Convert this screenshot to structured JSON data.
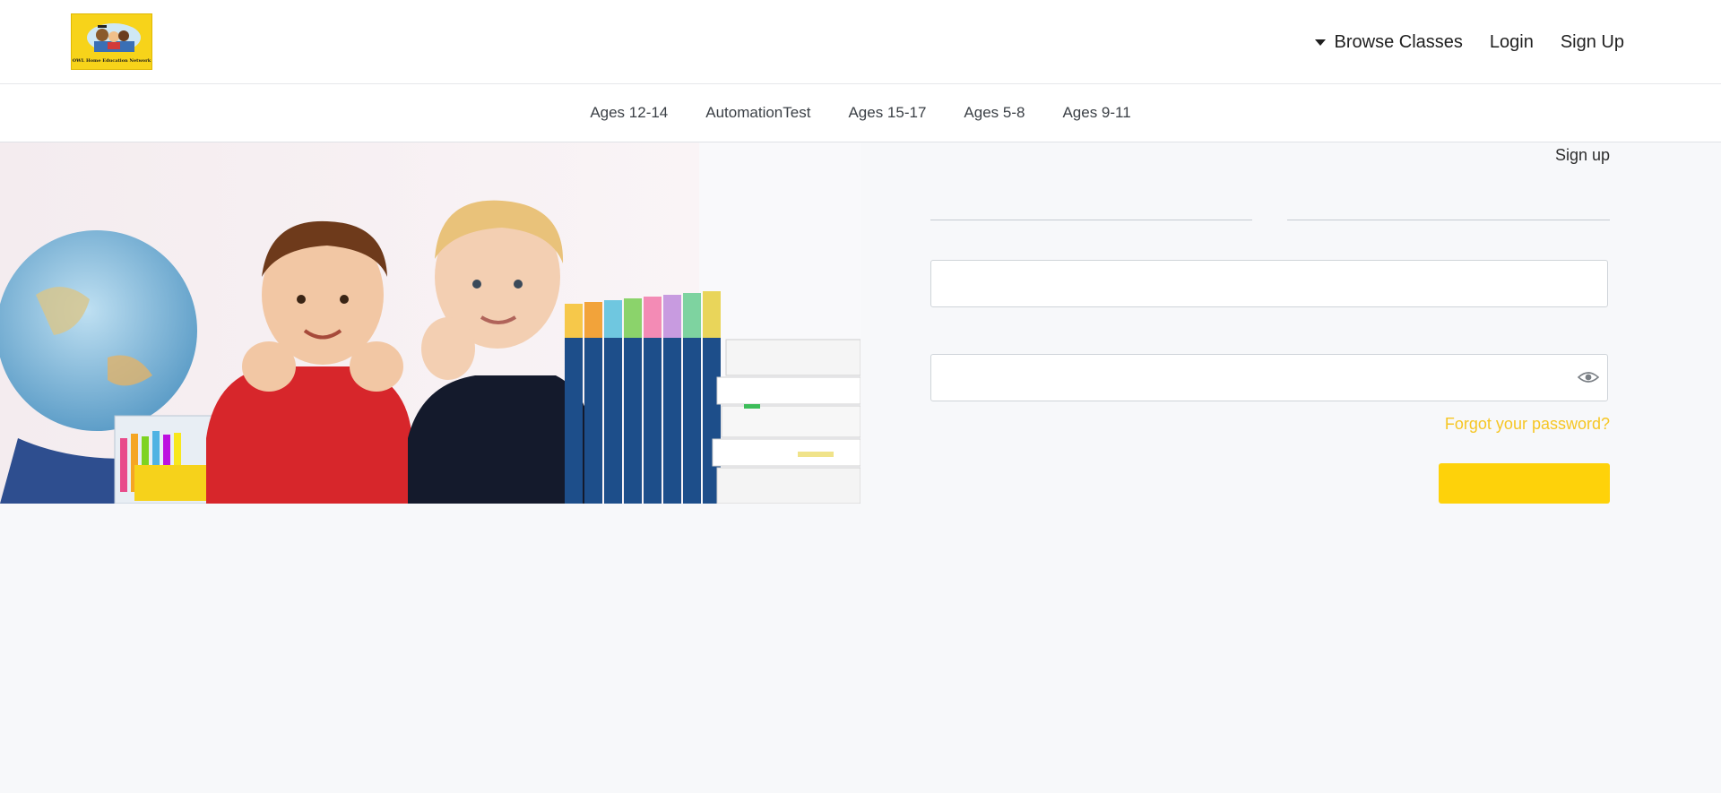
{
  "header": {
    "logo_text": "OWL Home Education Network",
    "nav": {
      "browse_label": "Browse Classes",
      "login_label": "Login",
      "signup_label": "Sign Up"
    }
  },
  "categories": [
    "Ages 12-14",
    "AutomationTest",
    "Ages 15-17",
    "Ages 5-8",
    "Ages 9-11"
  ],
  "form": {
    "signup_link": "Sign up",
    "email_value": "",
    "password_value": "",
    "forgot_label": "Forgot your password?",
    "submit_label": ""
  },
  "icons": {
    "dropdown": "caret-down-icon",
    "show_password": "eye-icon"
  },
  "colors": {
    "accent_yellow": "#fed20a",
    "link_yellow": "#f6c624",
    "page_bg": "#f7f8fa"
  }
}
